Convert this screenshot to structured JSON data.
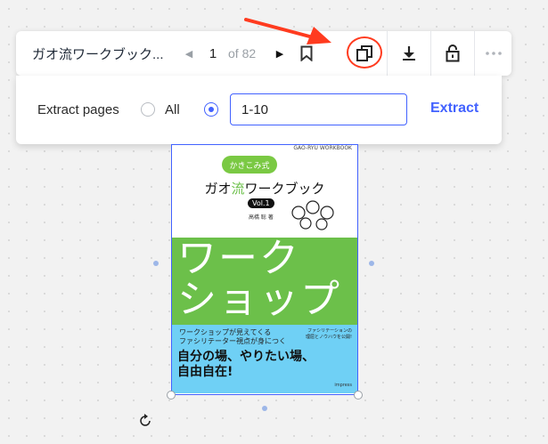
{
  "toolbar": {
    "doc_title": "ガオ流ワークブック...",
    "page_current": "1",
    "page_total_label": "of 82"
  },
  "extract_panel": {
    "label": "Extract pages",
    "option_all": "All",
    "range_value": "1-10",
    "extract_button": "Extract"
  },
  "book_cover": {
    "series": "GAO-RYU WORKBOOK",
    "bubble": "かきこみ式",
    "title_pre": "ガオ",
    "title_accent": "流",
    "title_post": "ワークブック",
    "vol": "Vol.1",
    "author": "高橋 聡 著",
    "big_line1": "ワーク",
    "big_line2": "ショップ",
    "sub_line1": "ワークショップが見えてくる",
    "sub_line2": "ファシリテーター視点が身につく",
    "sub_right1": "ファシリテーションの",
    "sub_right2": "理屈とノウハウを公開!",
    "big_blue_line1": "自分の場、やりたい場、",
    "big_blue_line2": "自由自在!",
    "publisher": "impress"
  },
  "colors": {
    "accent": "#4262ff",
    "highlight": "#ff3b1f",
    "book_green": "#6cc04a",
    "book_blue": "#6fd0f5"
  }
}
